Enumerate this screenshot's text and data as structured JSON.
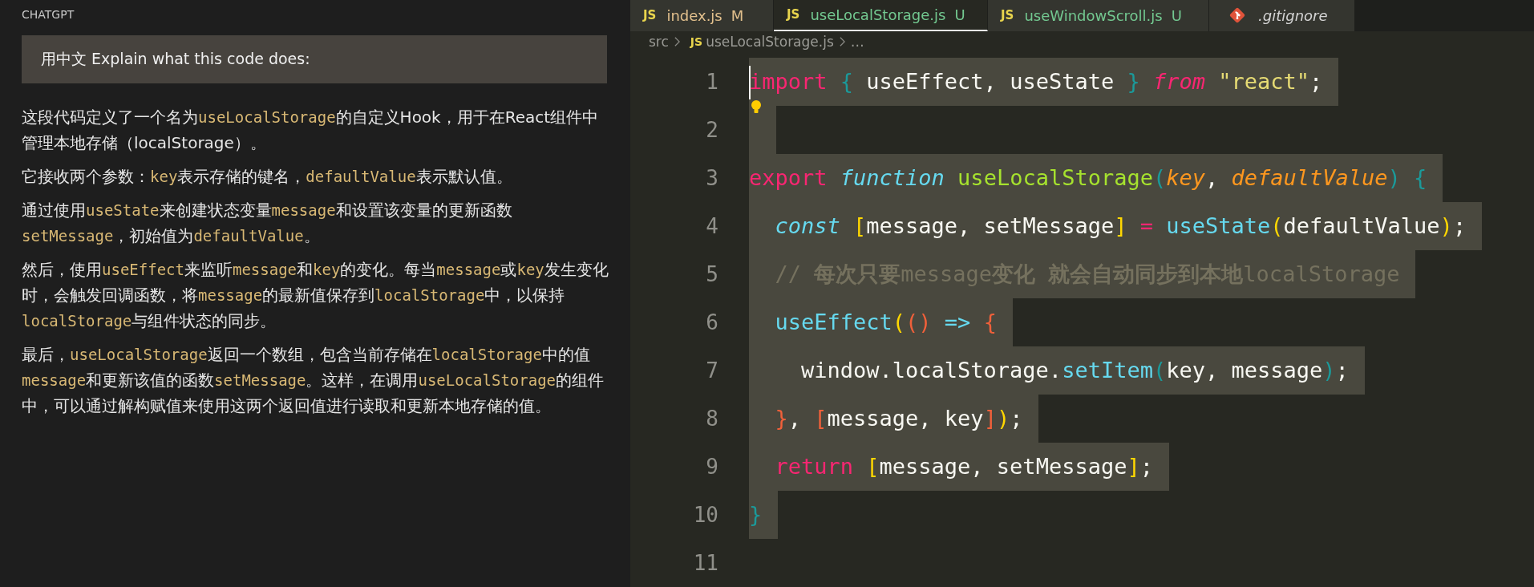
{
  "chat_panel": {
    "title": "CHATGPT",
    "prompt": "用中文 Explain what this code does:",
    "paragraphs": [
      [
        {
          "text": "这段代码定义了一个名为",
          "code": false
        },
        {
          "text": "useLocalStorage",
          "code": true
        },
        {
          "text": "的自定义Hook，用于在React组件中管理本地存储（localStorage）。",
          "code": false
        }
      ],
      [
        {
          "text": "它接收两个参数：",
          "code": false
        },
        {
          "text": "key",
          "code": true
        },
        {
          "text": "表示存储的键名，",
          "code": false
        },
        {
          "text": "defaultValue",
          "code": true
        },
        {
          "text": "表示默认值。",
          "code": false
        }
      ],
      [
        {
          "text": "通过使用",
          "code": false
        },
        {
          "text": "useState",
          "code": true
        },
        {
          "text": "来创建状态变量",
          "code": false
        },
        {
          "text": "message",
          "code": true
        },
        {
          "text": "和设置该变量的更新函数",
          "code": false
        },
        {
          "text": "setMessage",
          "code": true
        },
        {
          "text": "，初始值为",
          "code": false
        },
        {
          "text": "defaultValue",
          "code": true
        },
        {
          "text": "。",
          "code": false
        }
      ],
      [
        {
          "text": "然后，使用",
          "code": false
        },
        {
          "text": "useEffect",
          "code": true
        },
        {
          "text": "来监听",
          "code": false
        },
        {
          "text": "message",
          "code": true
        },
        {
          "text": "和",
          "code": false
        },
        {
          "text": "key",
          "code": true
        },
        {
          "text": "的变化。每当",
          "code": false
        },
        {
          "text": "message",
          "code": true
        },
        {
          "text": "或",
          "code": false
        },
        {
          "text": "key",
          "code": true
        },
        {
          "text": "发生变化时，会触发回调函数，将",
          "code": false
        },
        {
          "text": "message",
          "code": true
        },
        {
          "text": "的最新值保存到",
          "code": false
        },
        {
          "text": "localStorage",
          "code": true
        },
        {
          "text": "中，以保持",
          "code": false
        },
        {
          "text": "localStorage",
          "code": true
        },
        {
          "text": "与组件状态的同步。",
          "code": false
        }
      ],
      [
        {
          "text": "最后，",
          "code": false
        },
        {
          "text": "useLocalStorage",
          "code": true
        },
        {
          "text": "返回一个数组，包含当前存储在",
          "code": false
        },
        {
          "text": "localStorage",
          "code": true
        },
        {
          "text": "中的值",
          "code": false
        },
        {
          "text": "message",
          "code": true
        },
        {
          "text": "和更新该值的函数",
          "code": false
        },
        {
          "text": "setMessage",
          "code": true
        },
        {
          "text": "。这样，在调用",
          "code": false
        },
        {
          "text": "useLocalStorage",
          "code": true
        },
        {
          "text": "的组件中，可以通过解构赋值来使用这两个返回值进行读取和更新本地存储的值。",
          "code": false
        }
      ]
    ]
  },
  "tabs": [
    {
      "kind": "js",
      "icon": "JS",
      "label": "index.js",
      "status": "M",
      "color": "#e2c08d",
      "selected": false
    },
    {
      "kind": "js",
      "icon": "JS",
      "label": "useLocalStorage.js",
      "status": "U",
      "color": "#73c991",
      "selected": true
    },
    {
      "kind": "js",
      "icon": "JS",
      "label": "useWindowScroll.js",
      "status": "U",
      "color": "#73c991",
      "selected": false
    },
    {
      "kind": "git",
      "label": ".gitignore",
      "color": "#d4d4d4",
      "selected": false
    }
  ],
  "breadcrumbs": {
    "folder": "src",
    "file_icon": "JS",
    "file": "useLocalStorage.js",
    "more": "…"
  },
  "code_lines": [
    {
      "number": "1",
      "selected": true,
      "cursor": true,
      "lightbulb": false,
      "tokens": [
        {
          "text": "import",
          "kind": "kw"
        },
        {
          "text": " {",
          "kind": "teal"
        },
        {
          "text": " useEffect, useState ",
          "kind": "plain"
        },
        {
          "text": "}",
          "kind": "teal"
        },
        {
          "text": " from",
          "kind": "kwi"
        },
        {
          "text": " \"react\"",
          "kind": "str"
        },
        {
          "text": ";",
          "kind": "plain"
        }
      ]
    },
    {
      "number": "2",
      "selected": true,
      "cursor": false,
      "lightbulb": true
    },
    {
      "number": "3",
      "selected": true,
      "cursor": false,
      "lightbulb": false,
      "tokens": [
        {
          "text": "export",
          "kind": "kw"
        },
        {
          "text": " function",
          "kind": "storage"
        },
        {
          "text": " useLocalStorage",
          "kind": "fn"
        },
        {
          "text": "(",
          "kind": "teal"
        },
        {
          "text": "key",
          "kind": "param"
        },
        {
          "text": ",",
          "kind": "plain"
        },
        {
          "text": " defaultValue",
          "kind": "param"
        },
        {
          "text": ")",
          "kind": "teal"
        },
        {
          "text": " {",
          "kind": "teal"
        }
      ]
    },
    {
      "number": "4",
      "selected": true,
      "cursor": false,
      "lightbulb": false,
      "tokens": [
        {
          "text": "  const",
          "kind": "storage"
        },
        {
          "text": " [",
          "kind": "yellow"
        },
        {
          "text": "message, setMessage",
          "kind": "plain"
        },
        {
          "text": "]",
          "kind": "yellow"
        },
        {
          "text": " =",
          "kind": "kw"
        },
        {
          "text": " useState",
          "kind": "call"
        },
        {
          "text": "(",
          "kind": "yellow"
        },
        {
          "text": "defaultValue",
          "kind": "plain"
        },
        {
          "text": ")",
          "kind": "yellow"
        },
        {
          "text": ";",
          "kind": "plain"
        }
      ]
    },
    {
      "number": "5",
      "selected": true,
      "cursor": false,
      "lightbulb": false,
      "tokens": [
        {
          "text": "  //",
          "kind": "comment"
        },
        {
          "text": " 每次只要",
          "kind": "commentb"
        },
        {
          "text": "message",
          "kind": "comment"
        },
        {
          "text": "变化 就会自动同步到本地",
          "kind": "commentb"
        },
        {
          "text": "localStorage",
          "kind": "comment"
        }
      ]
    },
    {
      "number": "6",
      "selected": true,
      "cursor": false,
      "lightbulb": false,
      "tokens": [
        {
          "text": "  useEffect",
          "kind": "call"
        },
        {
          "text": "(",
          "kind": "yellow"
        },
        {
          "text": "()",
          "kind": "red"
        },
        {
          "text": " =>",
          "kind": "call"
        },
        {
          "text": " {",
          "kind": "red"
        }
      ]
    },
    {
      "number": "7",
      "selected": true,
      "cursor": false,
      "lightbulb": false,
      "tokens": [
        {
          "text": "    window.localStorage.",
          "kind": "plain"
        },
        {
          "text": "setItem",
          "kind": "call"
        },
        {
          "text": "(",
          "kind": "teal"
        },
        {
          "text": "key, message",
          "kind": "plain"
        },
        {
          "text": ")",
          "kind": "teal"
        },
        {
          "text": ";",
          "kind": "plain"
        }
      ]
    },
    {
      "number": "8",
      "selected": true,
      "cursor": false,
      "lightbulb": false,
      "tokens": [
        {
          "text": "  }",
          "kind": "red"
        },
        {
          "text": ",",
          "kind": "plain"
        },
        {
          "text": " [",
          "kind": "red"
        },
        {
          "text": "message, key",
          "kind": "plain"
        },
        {
          "text": "]",
          "kind": "red"
        },
        {
          "text": ")",
          "kind": "yellow"
        },
        {
          "text": ";",
          "kind": "plain"
        }
      ]
    },
    {
      "number": "9",
      "selected": true,
      "cursor": false,
      "lightbulb": false,
      "tokens": [
        {
          "text": "  return",
          "kind": "kw"
        },
        {
          "text": " [",
          "kind": "yellow"
        },
        {
          "text": "message, setMessage",
          "kind": "plain"
        },
        {
          "text": "]",
          "kind": "yellow"
        },
        {
          "text": ";",
          "kind": "plain"
        }
      ]
    },
    {
      "number": "10",
      "selected": true,
      "cursor": false,
      "lightbulb": false,
      "tokens": [
        {
          "text": "}",
          "kind": "teal"
        }
      ]
    },
    {
      "number": "11",
      "selected": false,
      "cursor": false,
      "lightbulb": false
    }
  ]
}
